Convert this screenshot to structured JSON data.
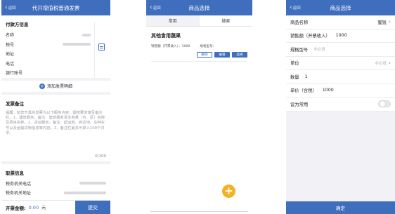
{
  "screen1": {
    "back": "返回",
    "title": "代开增值税普通发票",
    "payer_section": "付款方信息",
    "payer_fields": [
      "名称",
      "税号",
      "地址",
      "电话",
      "银行账号"
    ],
    "add_detail": "添加发票明细",
    "remark_section": "发票备注",
    "remark_placeholder": "提醒：如您开具的发票为以下服务内容，需按要求填写备注栏。1、建筑服务，备注：建筑服务发生地县（市、区）名称及项目名称。2、货运服务，备注：起运地、到达地、车种车号以及运输货物信息等内容。3、备注栏最多可录入100个汉字。",
    "remark_count": "0/100",
    "receive_section": "取票信息",
    "receive_fields": [
      "税务机关电话",
      "税务机关地址"
    ],
    "amount_label": "开票金额:",
    "amount_value": "0.00",
    "amount_unit": "元",
    "submit": "提交"
  },
  "screen2": {
    "back": "返回",
    "title": "商品选择",
    "tabs": [
      "常用",
      "搜索"
    ],
    "item_name": "其他食用蔬果",
    "item_sales": "销售额（开票收入）：1000",
    "item_model": "规格型号：",
    "btn_delete": "删除",
    "btn_edit": "编辑",
    "btn_select": "选择",
    "fab": "+"
  },
  "screen3": {
    "back": "返回",
    "title": "商品选择",
    "name_label": "商品名称",
    "name_value": "蜜钱",
    "sales_label": "销售额（开票收入）",
    "sales_value": "1000",
    "model_label": "规格型号",
    "model_placeholder": "非必填",
    "unit_label": "单位",
    "unit_placeholder": "非必填",
    "qty_label": "数量",
    "qty_value": "1",
    "price_label": "单价（含税）",
    "price_value": "1000",
    "common_label": "设为常用",
    "confirm": "确定"
  },
  "colors": {
    "primary": "#3f6ebd",
    "fab": "#f4b223",
    "background": "#f2f2f6"
  }
}
